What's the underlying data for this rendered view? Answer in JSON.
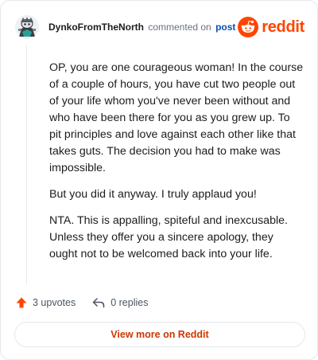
{
  "header": {
    "username": "DynkoFromTheNorth",
    "commented_text": "commented on",
    "post_link": "post",
    "brand_name": "reddit",
    "avatar_icon": "snoo-avatar-icon",
    "brand_icon": "reddit-snoo-logo-icon"
  },
  "comment": {
    "paragraphs": [
      "OP, you are one courageous woman! In the course of a couple of hours, you have cut two people out of your life whom you've never been without and who have been there for you as you grew up. To pit principles and love against each other like that takes guts. The decision you had to make was impossible.",
      "But you did it anyway. I truly applaud you!",
      "NTA. This is appalling, spiteful and inexcusable. Unless they offer you a sincere apology, they ought not to be welcomed back into your life."
    ]
  },
  "actions": {
    "upvotes_label": "3 upvotes",
    "replies_label": "0 replies",
    "upvote_icon": "upvote-arrow-icon",
    "reply_icon": "reply-arrow-icon"
  },
  "footer": {
    "view_more_label": "View more on Reddit"
  },
  "colors": {
    "brand": "#ff4500",
    "link": "#0a4fb5",
    "button_text": "#cc3700",
    "border": "#e5e7eb"
  }
}
